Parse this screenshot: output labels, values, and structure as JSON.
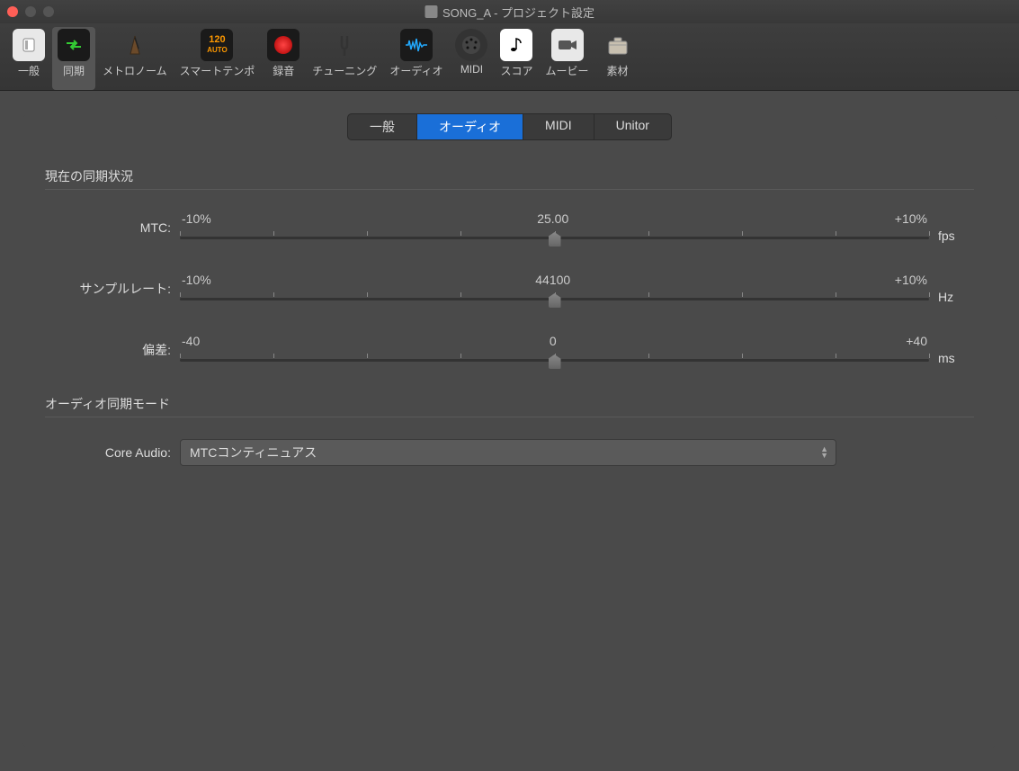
{
  "window": {
    "title": "SONG_A - プロジェクト設定"
  },
  "toolbar": {
    "items": [
      {
        "label": "一般"
      },
      {
        "label": "同期"
      },
      {
        "label": "メトロノーム"
      },
      {
        "label": "スマートテンポ"
      },
      {
        "label": "録音"
      },
      {
        "label": "チューニング"
      },
      {
        "label": "オーディオ"
      },
      {
        "label": "MIDI"
      },
      {
        "label": "スコア"
      },
      {
        "label": "ムービー"
      },
      {
        "label": "素材"
      }
    ]
  },
  "tabs": {
    "items": [
      {
        "label": "一般"
      },
      {
        "label": "オーディオ"
      },
      {
        "label": "MIDI"
      },
      {
        "label": "Unitor"
      }
    ]
  },
  "section1": {
    "title": "現在の同期状況"
  },
  "sliders": {
    "mtc": {
      "label": "MTC:",
      "min": "-10%",
      "value": "25.00",
      "max": "+10%",
      "unit": "fps"
    },
    "sample": {
      "label": "サンプルレート:",
      "min": "-10%",
      "value": "44100",
      "max": "+10%",
      "unit": "Hz"
    },
    "offset": {
      "label": "偏差:",
      "min": "-40",
      "value": "0",
      "max": "+40",
      "unit": "ms"
    }
  },
  "section2": {
    "title": "オーディオ同期モード"
  },
  "select": {
    "label": "Core Audio:",
    "value": "MTCコンティニュアス"
  }
}
